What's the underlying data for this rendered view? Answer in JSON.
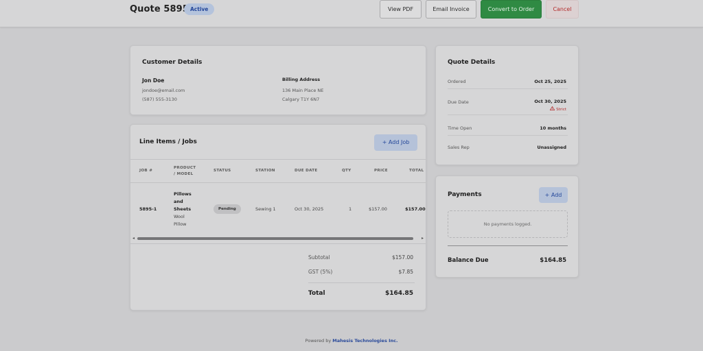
{
  "header": {
    "title": "Quote 5895",
    "status": "Active",
    "buttons": {
      "view_pdf": "View PDF",
      "email_invoice": "Email Invoice",
      "convert": "Convert to Order",
      "cancel": "Cancel"
    }
  },
  "customer": {
    "title": "Customer Details",
    "name": "Jon Doe",
    "email": "jondoe@email.com",
    "phone": "(587) 555-3130",
    "billing_label": "Billing Address",
    "address_line1": "136 Main Place NE",
    "address_line2": "Calgary T1Y 6N7"
  },
  "line_items": {
    "title": "Line Items / Jobs",
    "add_job_label": "+ Add Job",
    "columns": {
      "job": "JOB #",
      "product_1": "PRODUCT",
      "product_2": "/ MODEL",
      "status": "STATUS",
      "station": "STATION",
      "due_date": "DUE DATE",
      "qty": "QTY",
      "price": "PRICE",
      "total": "TOTAL"
    },
    "rows": [
      {
        "job": "5895-1",
        "product_lines": [
          "Pillows",
          "and",
          "Sheets"
        ],
        "model_lines": [
          "Wool",
          "Pillow"
        ],
        "status": "Pending",
        "station": "Sewing 1",
        "due_date": "Oct 30, 2025",
        "qty": "1",
        "price": "$157.00",
        "total": "$157.00"
      }
    ],
    "scroll_left": "◂",
    "scroll_right": "▸",
    "summary": {
      "subtotal_label": "Subtotal",
      "subtotal_value": "$157.00",
      "gst_label": "GST (5%)",
      "gst_value": "$7.85",
      "total_label": "Total",
      "total_value": "$164.85"
    }
  },
  "quote_details": {
    "title": "Quote Details",
    "ordered_label": "Ordered",
    "ordered_value": "Oct 25, 2025",
    "due_label": "Due Date",
    "due_value": "Oct 30, 2025",
    "strict_icon": "warning-triangle-icon",
    "strict_label": "Strict",
    "time_open_label": "Time Open",
    "time_open_value": "10 months",
    "sales_rep_label": "Sales Rep",
    "sales_rep_value": "Unassigned"
  },
  "payments": {
    "title": "Payments",
    "add_label": "+ Add",
    "empty_text": "No payments logged.",
    "balance_label": "Balance Due",
    "balance_value": "$164.85"
  },
  "footer": {
    "powered_by": "Powered by",
    "company": "Mahesis Technologies Inc."
  },
  "colors": {
    "accent": "#2f8a43",
    "status_active": "#b4c3dc",
    "danger": "#b32a2a",
    "link": "#2a4a9a"
  }
}
